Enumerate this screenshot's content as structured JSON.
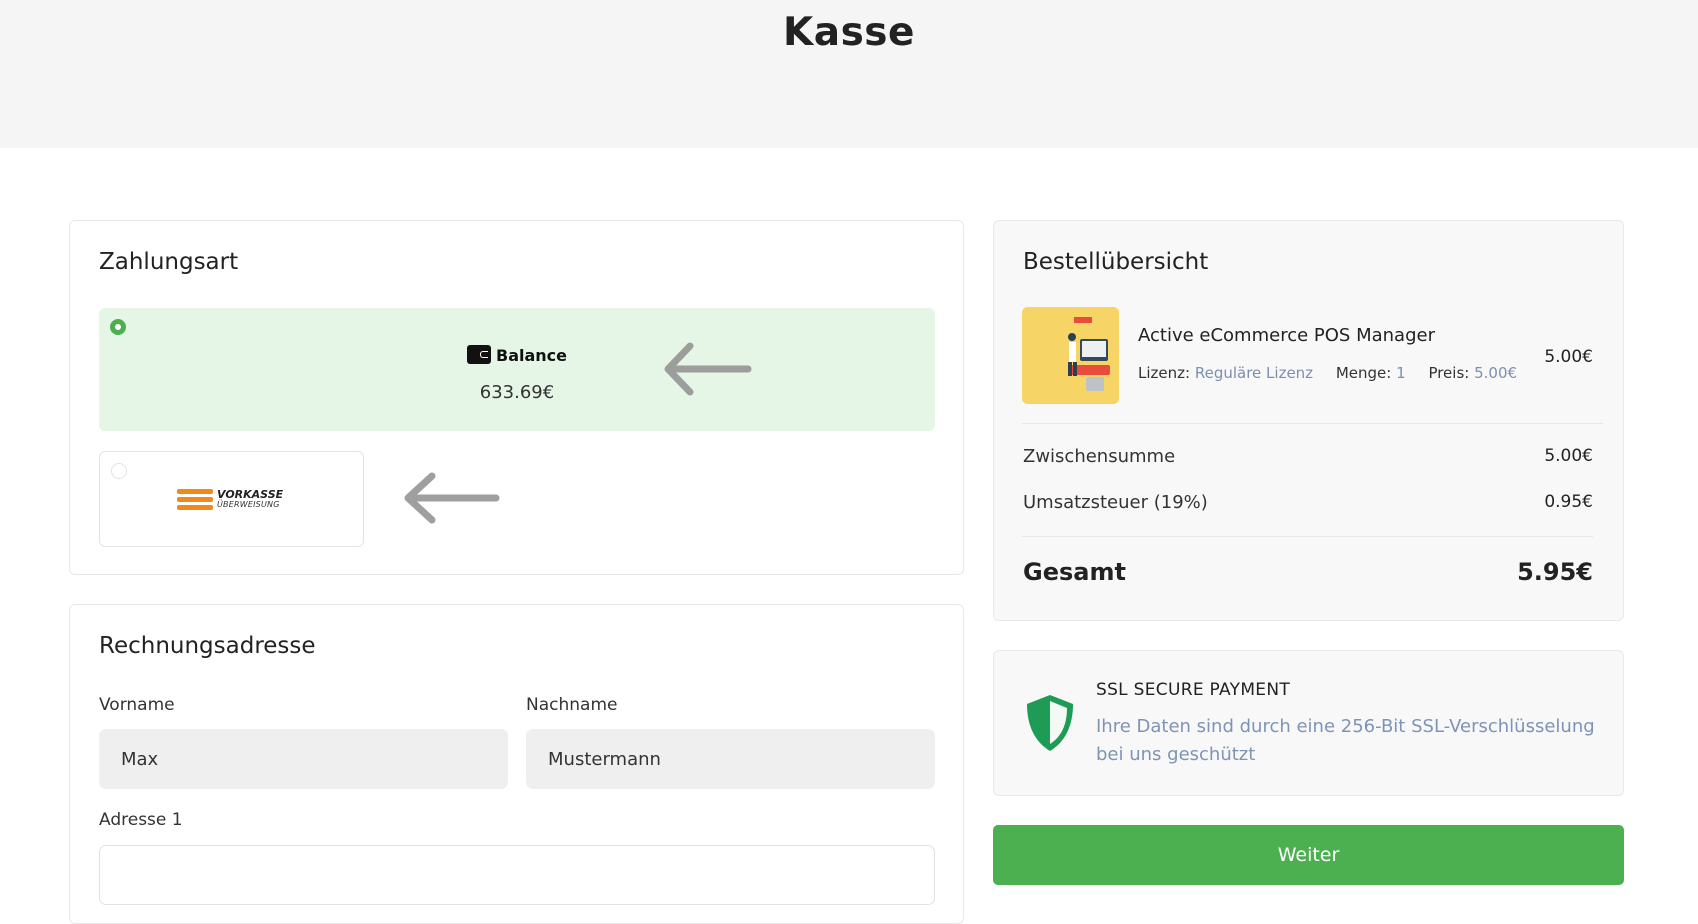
{
  "page": {
    "title": "Kasse"
  },
  "payment": {
    "title": "Zahlungsart",
    "options": [
      {
        "label": "Balance",
        "amount": "633.69€",
        "selected": true,
        "icon": "wallet-icon"
      },
      {
        "label_line1": "VORKASSE",
        "label_line2": "ÜBERWEISUNG",
        "selected": false,
        "icon": "vorkasse-logo"
      }
    ]
  },
  "billing": {
    "title": "Rechnungsadresse",
    "first_name_label": "Vorname",
    "first_name_value": "Max",
    "last_name_label": "Nachname",
    "last_name_value": "Mustermann",
    "address1_label": "Adresse 1",
    "address1_value": ""
  },
  "summary": {
    "title": "Bestellübersicht",
    "product": {
      "name": "Active eCommerce POS Manager",
      "license_label": "Lizenz:",
      "license_value": "Reguläre Lizenz",
      "qty_label": "Menge:",
      "qty_value": "1",
      "price_label": "Preis:",
      "price_value": "5.00€",
      "line_total": "5.00€"
    },
    "subtotal_label": "Zwischensumme",
    "subtotal_value": "5.00€",
    "tax_label": "Umsatzsteuer (19%)",
    "tax_value": "0.95€",
    "total_label": "Gesamt",
    "total_value": "5.95€"
  },
  "ssl": {
    "title": "SSL SECURE PAYMENT",
    "text": "Ihre Daten sind durch eine 256-Bit SSL-Verschlüsselung bei uns geschützt",
    "icon": "shield-icon"
  },
  "actions": {
    "continue_label": "Weiter"
  },
  "colors": {
    "accent": "#4caf50",
    "selected_bg": "#e6f6e6",
    "muted_link": "#7a8fb1",
    "vorkasse_orange": "#f28a1b"
  }
}
